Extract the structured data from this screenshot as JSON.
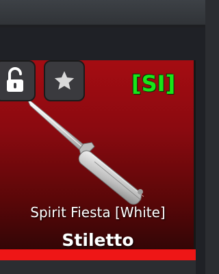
{
  "item": {
    "tag": "[SI]",
    "skin_name": "Spirit Fiesta [White]",
    "weapon_name": "Stiletto"
  },
  "buttons": {
    "lock_icon": "unlocked-padlock",
    "favorite_icon": "star"
  },
  "colors": {
    "card_top": "#a50c12",
    "card_bottom": "#2a0506",
    "rarity_bar": "#ee1616",
    "tag_text": "#19e619",
    "button_bg": "#3a3a3e"
  }
}
